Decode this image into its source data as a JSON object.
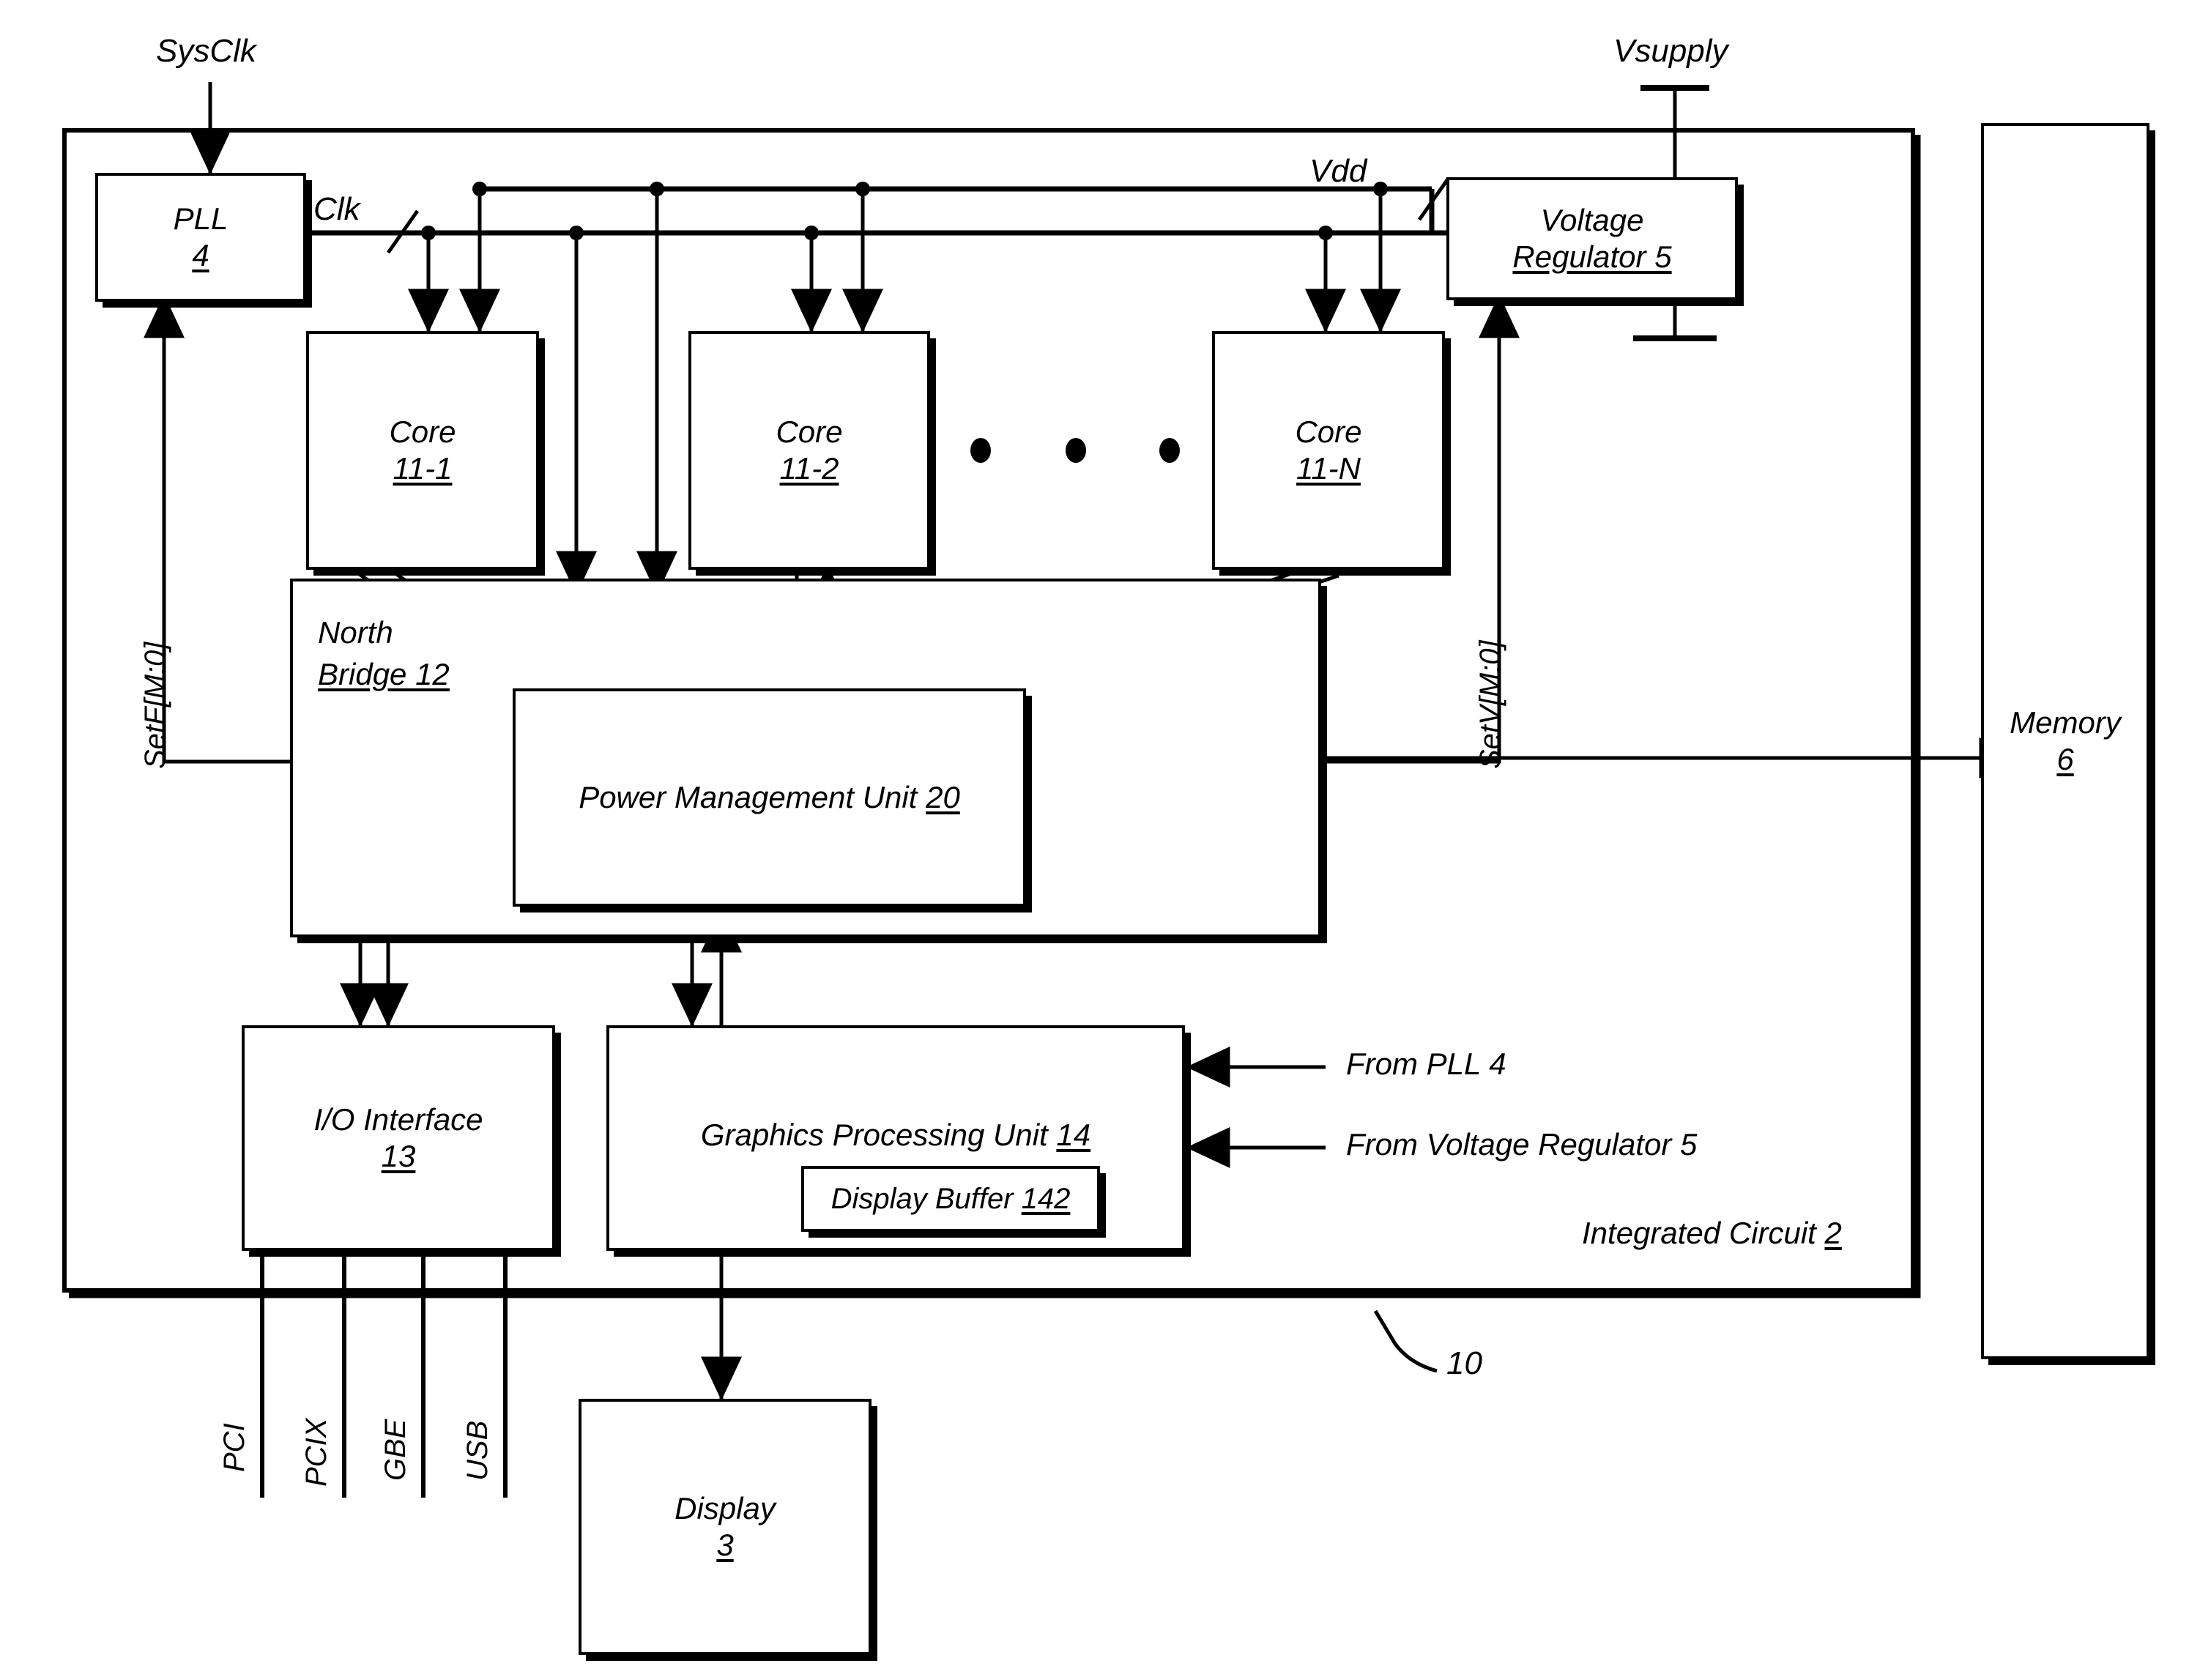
{
  "figure": {
    "reference_numeral": "10",
    "chip_label": "Integrated Circuit 2"
  },
  "external_signals": {
    "sysclk": "SysClk",
    "vsupply": "Vsupply",
    "clk": "Clk",
    "vdd": "Vdd",
    "setf": "SetF[M:0]",
    "setv": "SetV[M:0]"
  },
  "blocks": {
    "pll": {
      "line1": "PLL",
      "line2": "4"
    },
    "voltage_regulator": {
      "line1": "Voltage",
      "line2": "Regulator 5"
    },
    "core1": {
      "line1": "Core",
      "line2": "11-1"
    },
    "core2": {
      "line1": "Core",
      "line2": "11-2"
    },
    "coreN": {
      "line1": "Core",
      "line2": "11-N"
    },
    "north_bridge": {
      "line1": "North",
      "line2": "Bridge 12"
    },
    "pmu": {
      "line1": "Power Management Unit 20"
    },
    "io_interface": {
      "line1": "I/O Interface",
      "line2": "13"
    },
    "gpu": {
      "line1": "Graphics Processing Unit 14"
    },
    "display_buffer": {
      "line1": "Display Buffer 142"
    },
    "display": {
      "line1": "Display",
      "line2": "3"
    },
    "memory": {
      "line1": "Memory",
      "line2": "6"
    }
  },
  "annotations": {
    "from_pll": "From PLL 4",
    "from_voltage_regulator": "From Voltage Regulator 5"
  },
  "io_buses": [
    "PCI",
    "PCIX",
    "GBE",
    "USB"
  ],
  "ellipsis_dots": 3,
  "colors": {
    "line": "#000000",
    "background": "#ffffff"
  }
}
